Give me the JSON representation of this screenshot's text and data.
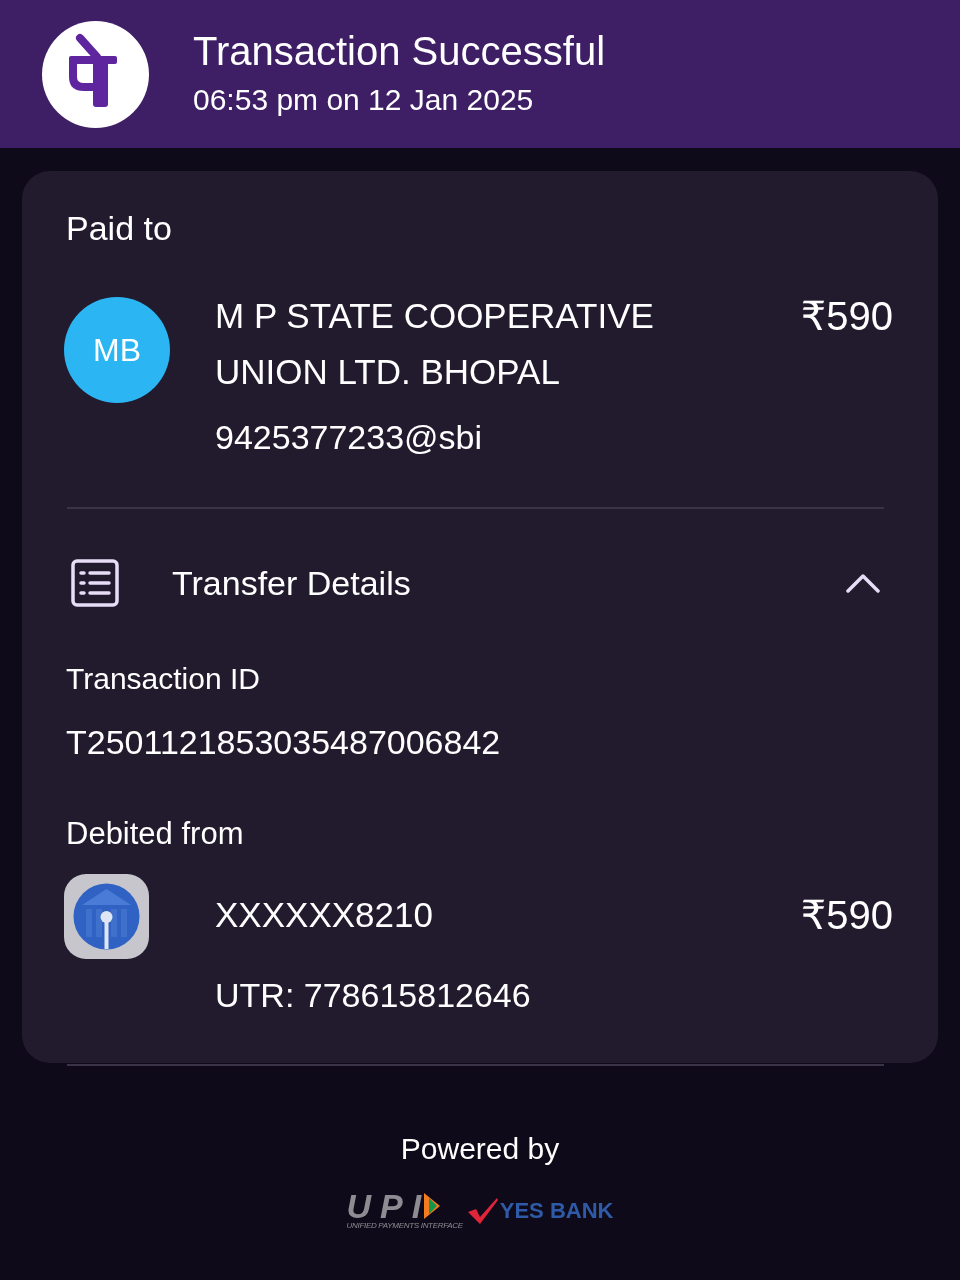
{
  "header": {
    "title": "Transaction Successful",
    "timestamp": "06:53 pm on 12 Jan 2025"
  },
  "paid_to": {
    "label": "Paid to",
    "initials": "MB",
    "name": "M P STATE COOPERATIVE UNION LTD. BHOPAL",
    "upi_id": "9425377233@sbi",
    "amount": "₹590"
  },
  "transfer_details": {
    "title": "Transfer Details",
    "expanded": true,
    "transaction_id_label": "Transaction ID",
    "transaction_id": "T2501121853035487006842",
    "debited_label": "Debited from",
    "account": "XXXXXX8210",
    "amount": "₹590",
    "utr": "UTR: 778615812646"
  },
  "footer": {
    "powered_by": "Powered by",
    "upi_logo": "UPI",
    "upi_tagline": "UNIFIED PAYMENTS INTERFACE",
    "bank_logo": "YES BANK"
  }
}
